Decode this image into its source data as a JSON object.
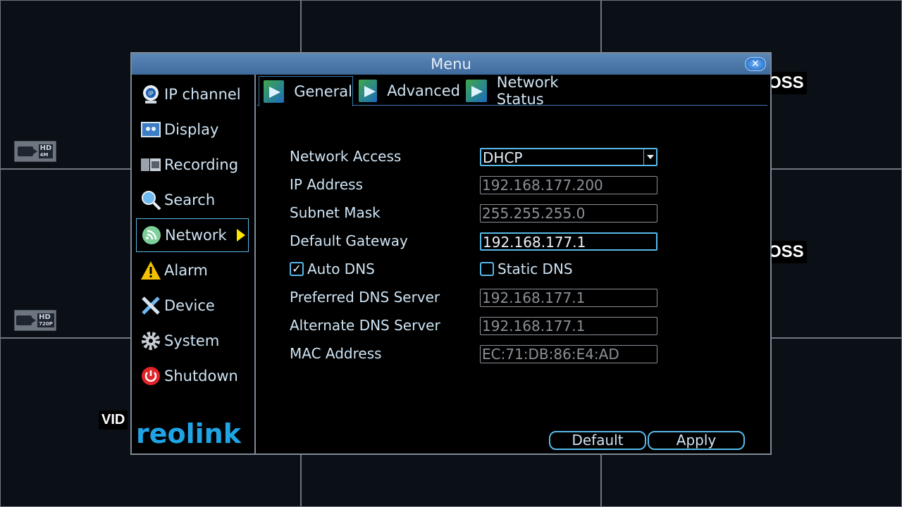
{
  "window": {
    "title": "Menu",
    "close_icon": "✕"
  },
  "background": {
    "badge_top": {
      "hd": "HD",
      "res": "4M"
    },
    "badge_bottom": {
      "hd": "HD",
      "res": "720P"
    },
    "loss_label_1": "OSS",
    "loss_label_2": "OSS",
    "video_label": "VID"
  },
  "sidebar": {
    "items": [
      {
        "label": "IP channel",
        "icon": "ip-camera-icon"
      },
      {
        "label": "Display",
        "icon": "display-icon"
      },
      {
        "label": "Recording",
        "icon": "recording-icon"
      },
      {
        "label": "Search",
        "icon": "search-icon"
      },
      {
        "label": "Network",
        "icon": "network-icon",
        "active": true
      },
      {
        "label": "Alarm",
        "icon": "alarm-icon"
      },
      {
        "label": "Device",
        "icon": "device-icon"
      },
      {
        "label": "System",
        "icon": "system-icon"
      },
      {
        "label": "Shutdown",
        "icon": "shutdown-icon"
      }
    ],
    "logo": "reolink"
  },
  "tabs": [
    {
      "label": "General",
      "active": true
    },
    {
      "label": "Advanced"
    },
    {
      "label": "Network Status"
    }
  ],
  "form": {
    "network_access": {
      "label": "Network Access",
      "value": "DHCP"
    },
    "ip_address": {
      "label": "IP Address",
      "value": "192.168.177.200"
    },
    "subnet_mask": {
      "label": "Subnet Mask",
      "value": "255.255.255.0"
    },
    "default_gateway": {
      "label": "Default Gateway",
      "value": "192.168.177.1"
    },
    "auto_dns": {
      "label": "Auto DNS",
      "checked": true,
      "mark": "✓"
    },
    "static_dns": {
      "label": "Static DNS",
      "checked": false
    },
    "preferred_dns": {
      "label": "Preferred DNS Server",
      "value": "192.168.177.1"
    },
    "alternate_dns": {
      "label": "Alternate DNS Server",
      "value": "192.168.177.1"
    },
    "mac_address": {
      "label": "MAC Address",
      "value": "EC:71:DB:86:E4:AD"
    }
  },
  "buttons": {
    "default": "Default",
    "apply": "Apply"
  },
  "colors": {
    "accent": "#58b9e8",
    "title_bar": "#4a78ab",
    "active_arrow": "#ffe600"
  }
}
